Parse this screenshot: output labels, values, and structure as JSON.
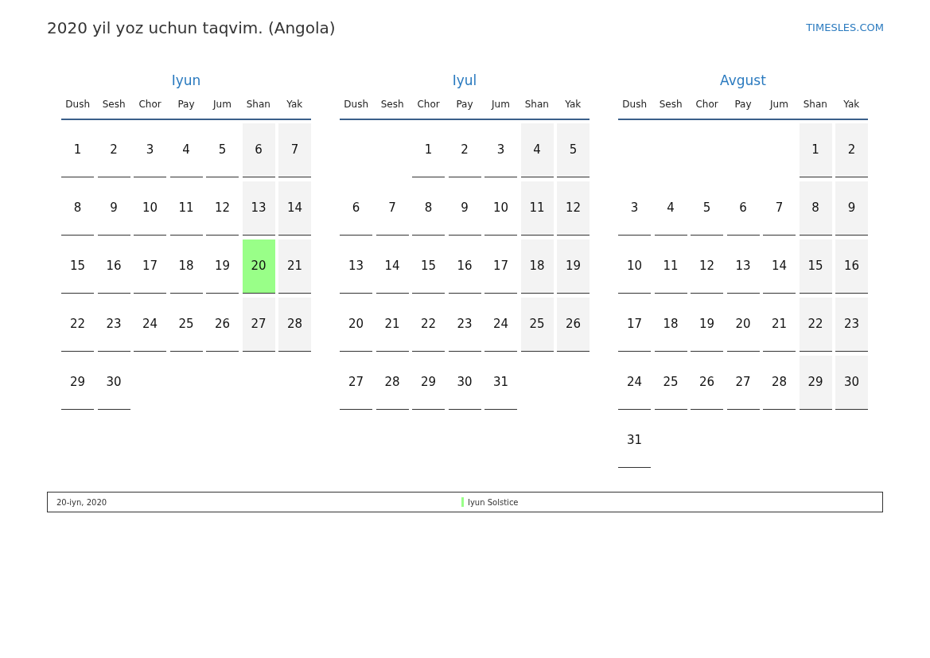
{
  "title": "2020 yil yoz uchun taqvim. (Angola)",
  "site": "TIMESLES.COM",
  "months": [
    {
      "name": "Iyun",
      "weekdays": [
        "Dush",
        "Sesh",
        "Chor",
        "Pay",
        "Jum",
        "Shan",
        "Yak"
      ],
      "weeks": [
        [
          {
            "kind": "day",
            "text": "1",
            "weekend": false
          },
          {
            "kind": "day",
            "text": "2",
            "weekend": false
          },
          {
            "kind": "day",
            "text": "3",
            "weekend": false
          },
          {
            "kind": "day",
            "text": "4",
            "weekend": false
          },
          {
            "kind": "day",
            "text": "5",
            "weekend": false
          },
          {
            "kind": "day",
            "text": "6",
            "weekend": true
          },
          {
            "kind": "day",
            "text": "7",
            "weekend": true
          }
        ],
        [
          {
            "kind": "day",
            "text": "8",
            "weekend": false
          },
          {
            "kind": "day",
            "text": "9",
            "weekend": false
          },
          {
            "kind": "day",
            "text": "10",
            "weekend": false
          },
          {
            "kind": "day",
            "text": "11",
            "weekend": false
          },
          {
            "kind": "day",
            "text": "12",
            "weekend": false
          },
          {
            "kind": "day",
            "text": "13",
            "weekend": true
          },
          {
            "kind": "day",
            "text": "14",
            "weekend": true
          }
        ],
        [
          {
            "kind": "day",
            "text": "15",
            "weekend": false
          },
          {
            "kind": "day",
            "text": "16",
            "weekend": false
          },
          {
            "kind": "day",
            "text": "17",
            "weekend": false
          },
          {
            "kind": "day",
            "text": "18",
            "weekend": false
          },
          {
            "kind": "day",
            "text": "19",
            "weekend": false
          },
          {
            "kind": "day",
            "text": "20",
            "color": "#99ff88"
          },
          {
            "kind": "day",
            "text": "21",
            "weekend": true
          }
        ],
        [
          {
            "kind": "day",
            "text": "22",
            "weekend": false
          },
          {
            "kind": "day",
            "text": "23",
            "weekend": false
          },
          {
            "kind": "day",
            "text": "24",
            "weekend": false
          },
          {
            "kind": "day",
            "text": "25",
            "weekend": false
          },
          {
            "kind": "day",
            "text": "26",
            "weekend": false
          },
          {
            "kind": "day",
            "text": "27",
            "weekend": true
          },
          {
            "kind": "day",
            "text": "28",
            "weekend": true
          }
        ],
        [
          {
            "kind": "day",
            "text": "29",
            "weekend": false
          },
          {
            "kind": "day",
            "text": "30",
            "weekend": false
          }
        ]
      ]
    },
    {
      "name": "Iyul",
      "weekdays": [
        "Dush",
        "Sesh",
        "Chor",
        "Pay",
        "Jum",
        "Shan",
        "Yak"
      ],
      "weeks": [
        [
          {
            "kind": "blank"
          },
          {
            "kind": "blank"
          },
          {
            "kind": "day",
            "text": "1",
            "weekend": false
          },
          {
            "kind": "day",
            "text": "2",
            "weekend": false
          },
          {
            "kind": "day",
            "text": "3",
            "weekend": false
          },
          {
            "kind": "day",
            "text": "4",
            "weekend": true
          },
          {
            "kind": "day",
            "text": "5",
            "weekend": true
          }
        ],
        [
          {
            "kind": "day",
            "text": "6",
            "weekend": false
          },
          {
            "kind": "day",
            "text": "7",
            "weekend": false
          },
          {
            "kind": "day",
            "text": "8",
            "weekend": false
          },
          {
            "kind": "day",
            "text": "9",
            "weekend": false
          },
          {
            "kind": "day",
            "text": "10",
            "weekend": false
          },
          {
            "kind": "day",
            "text": "11",
            "weekend": true
          },
          {
            "kind": "day",
            "text": "12",
            "weekend": true
          }
        ],
        [
          {
            "kind": "day",
            "text": "13",
            "weekend": false
          },
          {
            "kind": "day",
            "text": "14",
            "weekend": false
          },
          {
            "kind": "day",
            "text": "15",
            "weekend": false
          },
          {
            "kind": "day",
            "text": "16",
            "weekend": false
          },
          {
            "kind": "day",
            "text": "17",
            "weekend": false
          },
          {
            "kind": "day",
            "text": "18",
            "weekend": true
          },
          {
            "kind": "day",
            "text": "19",
            "weekend": true
          }
        ],
        [
          {
            "kind": "day",
            "text": "20",
            "weekend": false
          },
          {
            "kind": "day",
            "text": "21",
            "weekend": false
          },
          {
            "kind": "day",
            "text": "22",
            "weekend": false
          },
          {
            "kind": "day",
            "text": "23",
            "weekend": false
          },
          {
            "kind": "day",
            "text": "24",
            "weekend": false
          },
          {
            "kind": "day",
            "text": "25",
            "weekend": true
          },
          {
            "kind": "day",
            "text": "26",
            "weekend": true
          }
        ],
        [
          {
            "kind": "day",
            "text": "27",
            "weekend": false
          },
          {
            "kind": "day",
            "text": "28",
            "weekend": false
          },
          {
            "kind": "day",
            "text": "29",
            "weekend": false
          },
          {
            "kind": "day",
            "text": "30",
            "weekend": false
          },
          {
            "kind": "day",
            "text": "31",
            "weekend": false
          }
        ]
      ]
    },
    {
      "name": "Avgust",
      "weekdays": [
        "Dush",
        "Sesh",
        "Chor",
        "Pay",
        "Jum",
        "Shan",
        "Yak"
      ],
      "weeks": [
        [
          {
            "kind": "blank"
          },
          {
            "kind": "blank"
          },
          {
            "kind": "blank"
          },
          {
            "kind": "blank"
          },
          {
            "kind": "blank"
          },
          {
            "kind": "day",
            "text": "1",
            "weekend": true
          },
          {
            "kind": "day",
            "text": "2",
            "weekend": true
          }
        ],
        [
          {
            "kind": "day",
            "text": "3",
            "weekend": false
          },
          {
            "kind": "day",
            "text": "4",
            "weekend": false
          },
          {
            "kind": "day",
            "text": "5",
            "weekend": false
          },
          {
            "kind": "day",
            "text": "6",
            "weekend": false
          },
          {
            "kind": "day",
            "text": "7",
            "weekend": false
          },
          {
            "kind": "day",
            "text": "8",
            "weekend": true
          },
          {
            "kind": "day",
            "text": "9",
            "weekend": true
          }
        ],
        [
          {
            "kind": "day",
            "text": "10",
            "weekend": false
          },
          {
            "kind": "day",
            "text": "11",
            "weekend": false
          },
          {
            "kind": "day",
            "text": "12",
            "weekend": false
          },
          {
            "kind": "day",
            "text": "13",
            "weekend": false
          },
          {
            "kind": "day",
            "text": "14",
            "weekend": false
          },
          {
            "kind": "day",
            "text": "15",
            "weekend": true
          },
          {
            "kind": "day",
            "text": "16",
            "weekend": true
          }
        ],
        [
          {
            "kind": "day",
            "text": "17",
            "weekend": false
          },
          {
            "kind": "day",
            "text": "18",
            "weekend": false
          },
          {
            "kind": "day",
            "text": "19",
            "weekend": false
          },
          {
            "kind": "day",
            "text": "20",
            "weekend": false
          },
          {
            "kind": "day",
            "text": "21",
            "weekend": false
          },
          {
            "kind": "day",
            "text": "22",
            "weekend": true
          },
          {
            "kind": "day",
            "text": "23",
            "weekend": true
          }
        ],
        [
          {
            "kind": "day",
            "text": "24",
            "weekend": false
          },
          {
            "kind": "day",
            "text": "25",
            "weekend": false
          },
          {
            "kind": "day",
            "text": "26",
            "weekend": false
          },
          {
            "kind": "day",
            "text": "27",
            "weekend": false
          },
          {
            "kind": "day",
            "text": "28",
            "weekend": false
          },
          {
            "kind": "day",
            "text": "29",
            "weekend": true
          },
          {
            "kind": "day",
            "text": "30",
            "weekend": true
          }
        ],
        [
          {
            "kind": "day",
            "text": "31",
            "weekend": false
          }
        ]
      ]
    }
  ],
  "legend": [
    {
      "date": "20-iyn, 2020",
      "name": "Iyun Solstice",
      "color": "#99ff88"
    }
  ]
}
